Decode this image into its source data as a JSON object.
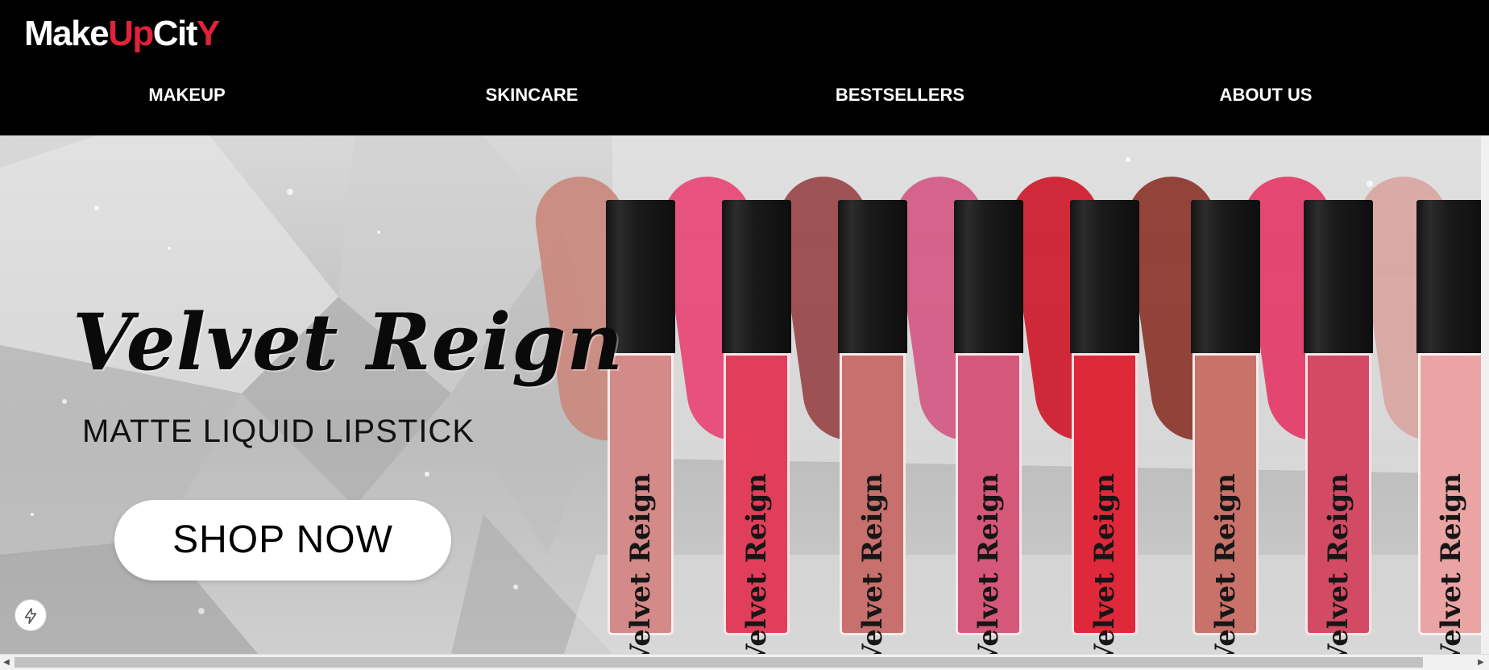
{
  "logo": {
    "part1": "Make",
    "part2": "Up",
    "part3": "Cit",
    "part4": "Y"
  },
  "nav": {
    "items": [
      {
        "label": "MAKEUP"
      },
      {
        "label": "SKINCARE"
      },
      {
        "label": "BESTSELLERS"
      },
      {
        "label": "ABOUT US"
      }
    ]
  },
  "hero": {
    "title": "Velvet Reign",
    "subtitle": "MATTE LIQUID LIPSTICK",
    "cta": "SHOP NOW",
    "tube_label": "Velvet Reign",
    "shades": [
      "#d48a88",
      "#e03e5a",
      "#c7706d",
      "#d5587a",
      "#e0283b",
      "#c9726a",
      "#d24a64",
      "#e9a4a3"
    ],
    "swatches": [
      "#c98a80",
      "#e84a78",
      "#9a4a4c",
      "#d35d86",
      "#cf2030",
      "#8e3b30",
      "#e43e6a",
      "#d9a6a2"
    ]
  },
  "colors": {
    "header_bg": "#000000",
    "accent": "#e0233a"
  },
  "icons": {
    "flash": "lightning-icon"
  }
}
